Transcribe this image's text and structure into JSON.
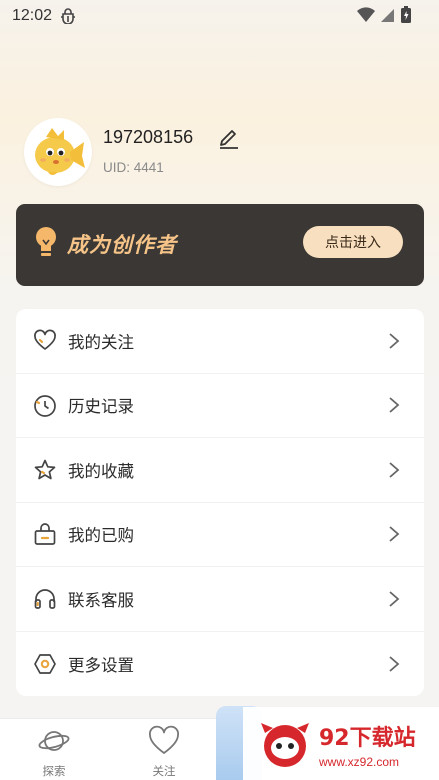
{
  "status_bar": {
    "time": "12:02",
    "icons": [
      "bug-icon",
      "wifi-icon",
      "signal-icon",
      "battery-icon"
    ]
  },
  "profile": {
    "avatar": "fish-avatar",
    "username": "197208156",
    "uid": "UID: 4441"
  },
  "creator_banner": {
    "title": "成为创作者",
    "button": "点击进入",
    "colors": {
      "background": "#3a3734",
      "title": "#f6c488",
      "button": "#f8dfc0"
    }
  },
  "menu": {
    "items": [
      {
        "label": "我的关注",
        "icon": "heart-icon"
      },
      {
        "label": "历史记录",
        "icon": "clock-icon"
      },
      {
        "label": "我的收藏",
        "icon": "star-icon"
      },
      {
        "label": "我的已购",
        "icon": "bag-icon"
      },
      {
        "label": "联系客服",
        "icon": "headset-icon"
      },
      {
        "label": "更多设置",
        "icon": "settings-icon"
      }
    ]
  },
  "tabbar": {
    "tabs": [
      {
        "label": "探索",
        "icon": "planet-icon"
      },
      {
        "label": "关注",
        "icon": "heart-icon"
      }
    ]
  },
  "watermark": {
    "title": "92下载站",
    "url": "www.xz92.com"
  }
}
